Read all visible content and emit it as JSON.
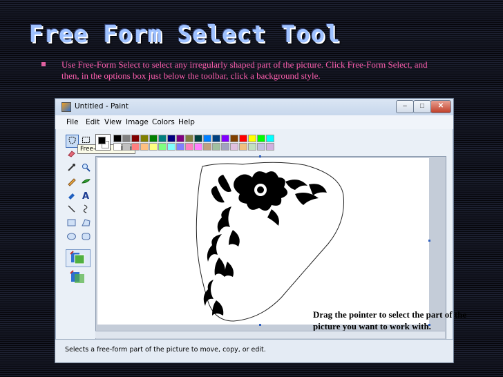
{
  "slide": {
    "title": "Free Form Select Tool",
    "bullet": "Use Free-Form Select to select any irregularly shaped part of the picture. Click Free-Form Select, and then, in the options box just below the toolbar, click a background style."
  },
  "window": {
    "title": "Untitled - Paint",
    "minimize": "–",
    "maximize": "□",
    "close": "✕"
  },
  "menu": [
    "File",
    "Edit",
    "View",
    "Image",
    "Colors",
    "Help"
  ],
  "tooltip": "Free-Form Select",
  "callout": "Drag the pointer to select the part of the picture you want to work with.",
  "status": "Selects a free-form part of the picture to move, copy, or edit.",
  "tools": [
    "free-form-select-icon",
    "select-icon",
    "eraser-icon",
    "fill-icon",
    "color-picker-icon",
    "magnifier-icon",
    "pencil-icon",
    "brush-icon",
    "airbrush-icon",
    "text-icon",
    "line-icon",
    "curve-icon",
    "rectangle-icon",
    "polygon-icon",
    "ellipse-icon",
    "rounded-rectangle-icon"
  ],
  "palette": {
    "row1": [
      "#000000",
      "#808080",
      "#800000",
      "#808000",
      "#008000",
      "#008080",
      "#000080",
      "#800080",
      "#808040",
      "#004040",
      "#0080ff",
      "#004080",
      "#8000ff",
      "#804000",
      "#ff0000",
      "#ffff00",
      "#00ff00",
      "#00ffff"
    ],
    "row2": [
      "#ffffff",
      "#c0c0c0",
      "#ff8080",
      "#ffc080",
      "#ffff80",
      "#80ff80",
      "#80ffff",
      "#8080ff",
      "#ff80c0",
      "#ff80ff",
      "#c0a080",
      "#a0c0a0",
      "#a0a0c0",
      "#e0c0e0",
      "#f0c080",
      "#c0e0c0",
      "#c0c0e0",
      "#d0b0e0"
    ]
  }
}
